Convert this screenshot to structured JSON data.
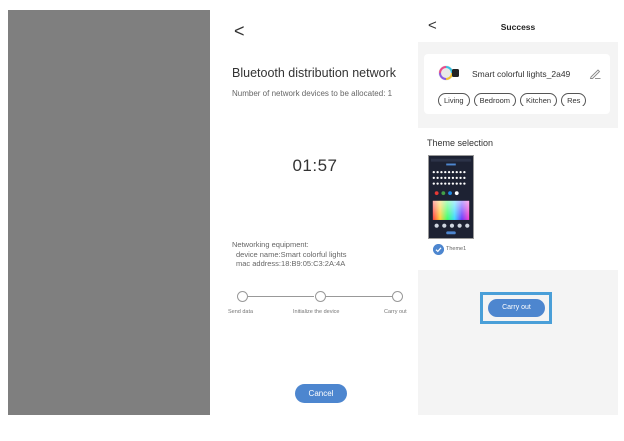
{
  "middle": {
    "back_glyph": "<",
    "title": "Bluetooth distribution network",
    "subtitle": "Number of network devices to be allocated: 1",
    "timer": "01:57",
    "equipment": {
      "heading": "Networking equipment:",
      "device_name": "device name:Smart colorful lights",
      "mac_address": "mac address:18:B9:05:C3:2A:4A"
    },
    "steps": [
      "Send data",
      "Initialize the device",
      "Carry out"
    ],
    "cancel_label": "Cancel"
  },
  "right": {
    "back_glyph": "<",
    "title": "Success",
    "device_name": "Smart colorful lights_2a49",
    "rooms": [
      "Living",
      "Bedroom",
      "Kitchen",
      "Res"
    ],
    "theme_heading": "Theme selection",
    "theme_name": "Theme1",
    "carry_out_label": "Carry out"
  },
  "colors": {
    "accent": "#4d86cf",
    "highlight": "#4a9fd8",
    "left_panel": "#7f7f7f"
  },
  "icons": [
    "back-arrow-icon",
    "bulb-icon",
    "edit-pencil-icon",
    "checkmark-icon"
  ]
}
